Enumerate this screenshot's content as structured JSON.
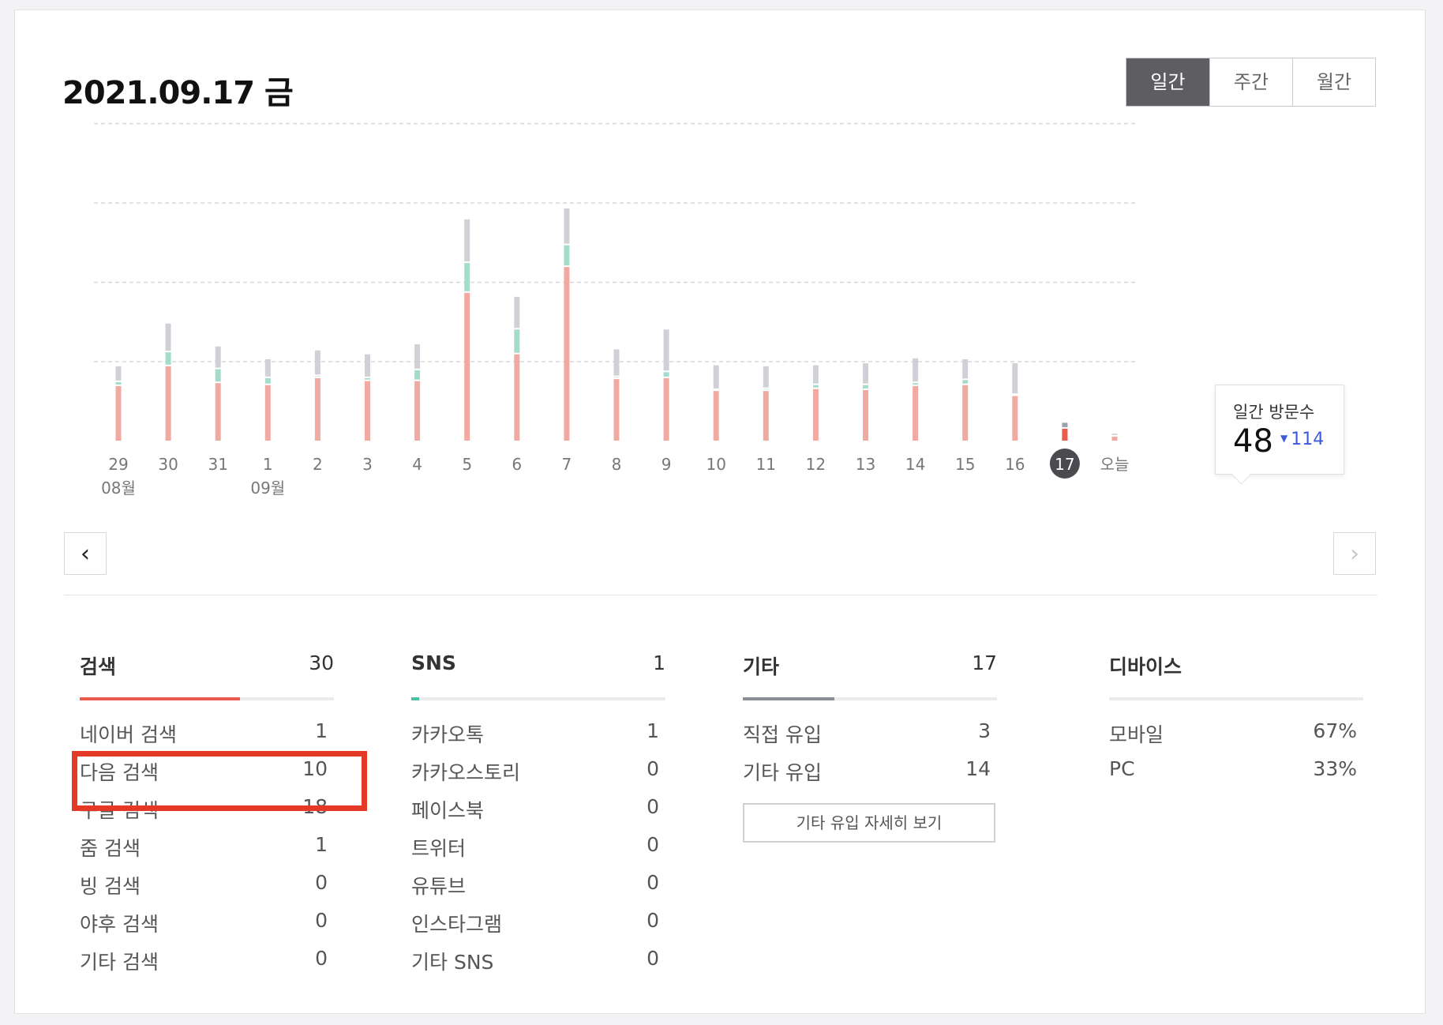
{
  "header": {
    "date": "2021.09.17 금"
  },
  "period_toggle": {
    "options": [
      "일간",
      "주간",
      "월간"
    ],
    "active": "일간"
  },
  "tooltip": {
    "label": "일간 방문수",
    "value": "48",
    "previous": "114"
  },
  "colors": {
    "search": "#f0aaa2",
    "sns": "#a4dccc",
    "other": "#cfd1d6",
    "selected_search": "#ec5a4c",
    "selected_other": "#9da0a8"
  },
  "chart_data": {
    "type": "bar",
    "stacked": true,
    "categories": [
      "29",
      "30",
      "31",
      "1",
      "2",
      "3",
      "4",
      "5",
      "6",
      "7",
      "8",
      "9",
      "10",
      "11",
      "12",
      "13",
      "14",
      "15",
      "16",
      "17",
      "오늘"
    ],
    "month_labels": [
      {
        "at": "29",
        "label": "08월"
      },
      {
        "at": "1",
        "label": "09월"
      }
    ],
    "selected": "17",
    "series": [
      {
        "key": "search",
        "values": [
          55,
          75,
          58,
          56,
          63,
          60,
          60,
          149,
          87,
          175,
          62,
          63,
          50,
          50,
          52,
          51,
          55,
          56,
          45,
          12,
          4
        ]
      },
      {
        "key": "sns",
        "values": [
          4,
          14,
          14,
          7,
          2,
          3,
          11,
          30,
          25,
          22,
          2,
          6,
          1,
          2,
          4,
          5,
          3,
          5,
          1,
          0,
          0
        ]
      },
      {
        "key": "other",
        "values": [
          16,
          29,
          23,
          19,
          26,
          24,
          26,
          44,
          33,
          37,
          28,
          43,
          25,
          23,
          20,
          22,
          25,
          21,
          32,
          6,
          3
        ]
      }
    ],
    "ylim": [
      0,
      320
    ],
    "grid": true
  },
  "stats": {
    "search": {
      "label": "검색",
      "total": "30",
      "bar_ratio": 0.63,
      "color": "#ec5a4c",
      "rows": [
        {
          "label": "네이버 검색",
          "value": "1"
        },
        {
          "label": "다음 검색",
          "value": "10"
        },
        {
          "label": "구글 검색",
          "value": "18"
        },
        {
          "label": "줌 검색",
          "value": "1"
        },
        {
          "label": "빙 검색",
          "value": "0"
        },
        {
          "label": "야후 검색",
          "value": "0"
        },
        {
          "label": "기타 검색",
          "value": "0"
        }
      ]
    },
    "sns": {
      "label": "SNS",
      "total": "1",
      "bar_ratio": 0.03,
      "color": "#4cbfa6",
      "rows": [
        {
          "label": "카카오톡",
          "value": "1"
        },
        {
          "label": "카카오스토리",
          "value": "0"
        },
        {
          "label": "페이스북",
          "value": "0"
        },
        {
          "label": "트위터",
          "value": "0"
        },
        {
          "label": "유튜브",
          "value": "0"
        },
        {
          "label": "인스타그램",
          "value": "0"
        },
        {
          "label": "기타 SNS",
          "value": "0"
        }
      ]
    },
    "other": {
      "label": "기타",
      "total": "17",
      "bar_ratio": 0.36,
      "color": "#8a8e96",
      "rows": [
        {
          "label": "직접 유입",
          "value": "3"
        },
        {
          "label": "기타 유입",
          "value": "14"
        }
      ],
      "detail_button": "기타 유입 자세히 보기"
    },
    "device": {
      "label": "디바이스",
      "rows": [
        {
          "label": "모바일",
          "value": "67%"
        },
        {
          "label": "PC",
          "value": "33%"
        }
      ]
    }
  }
}
